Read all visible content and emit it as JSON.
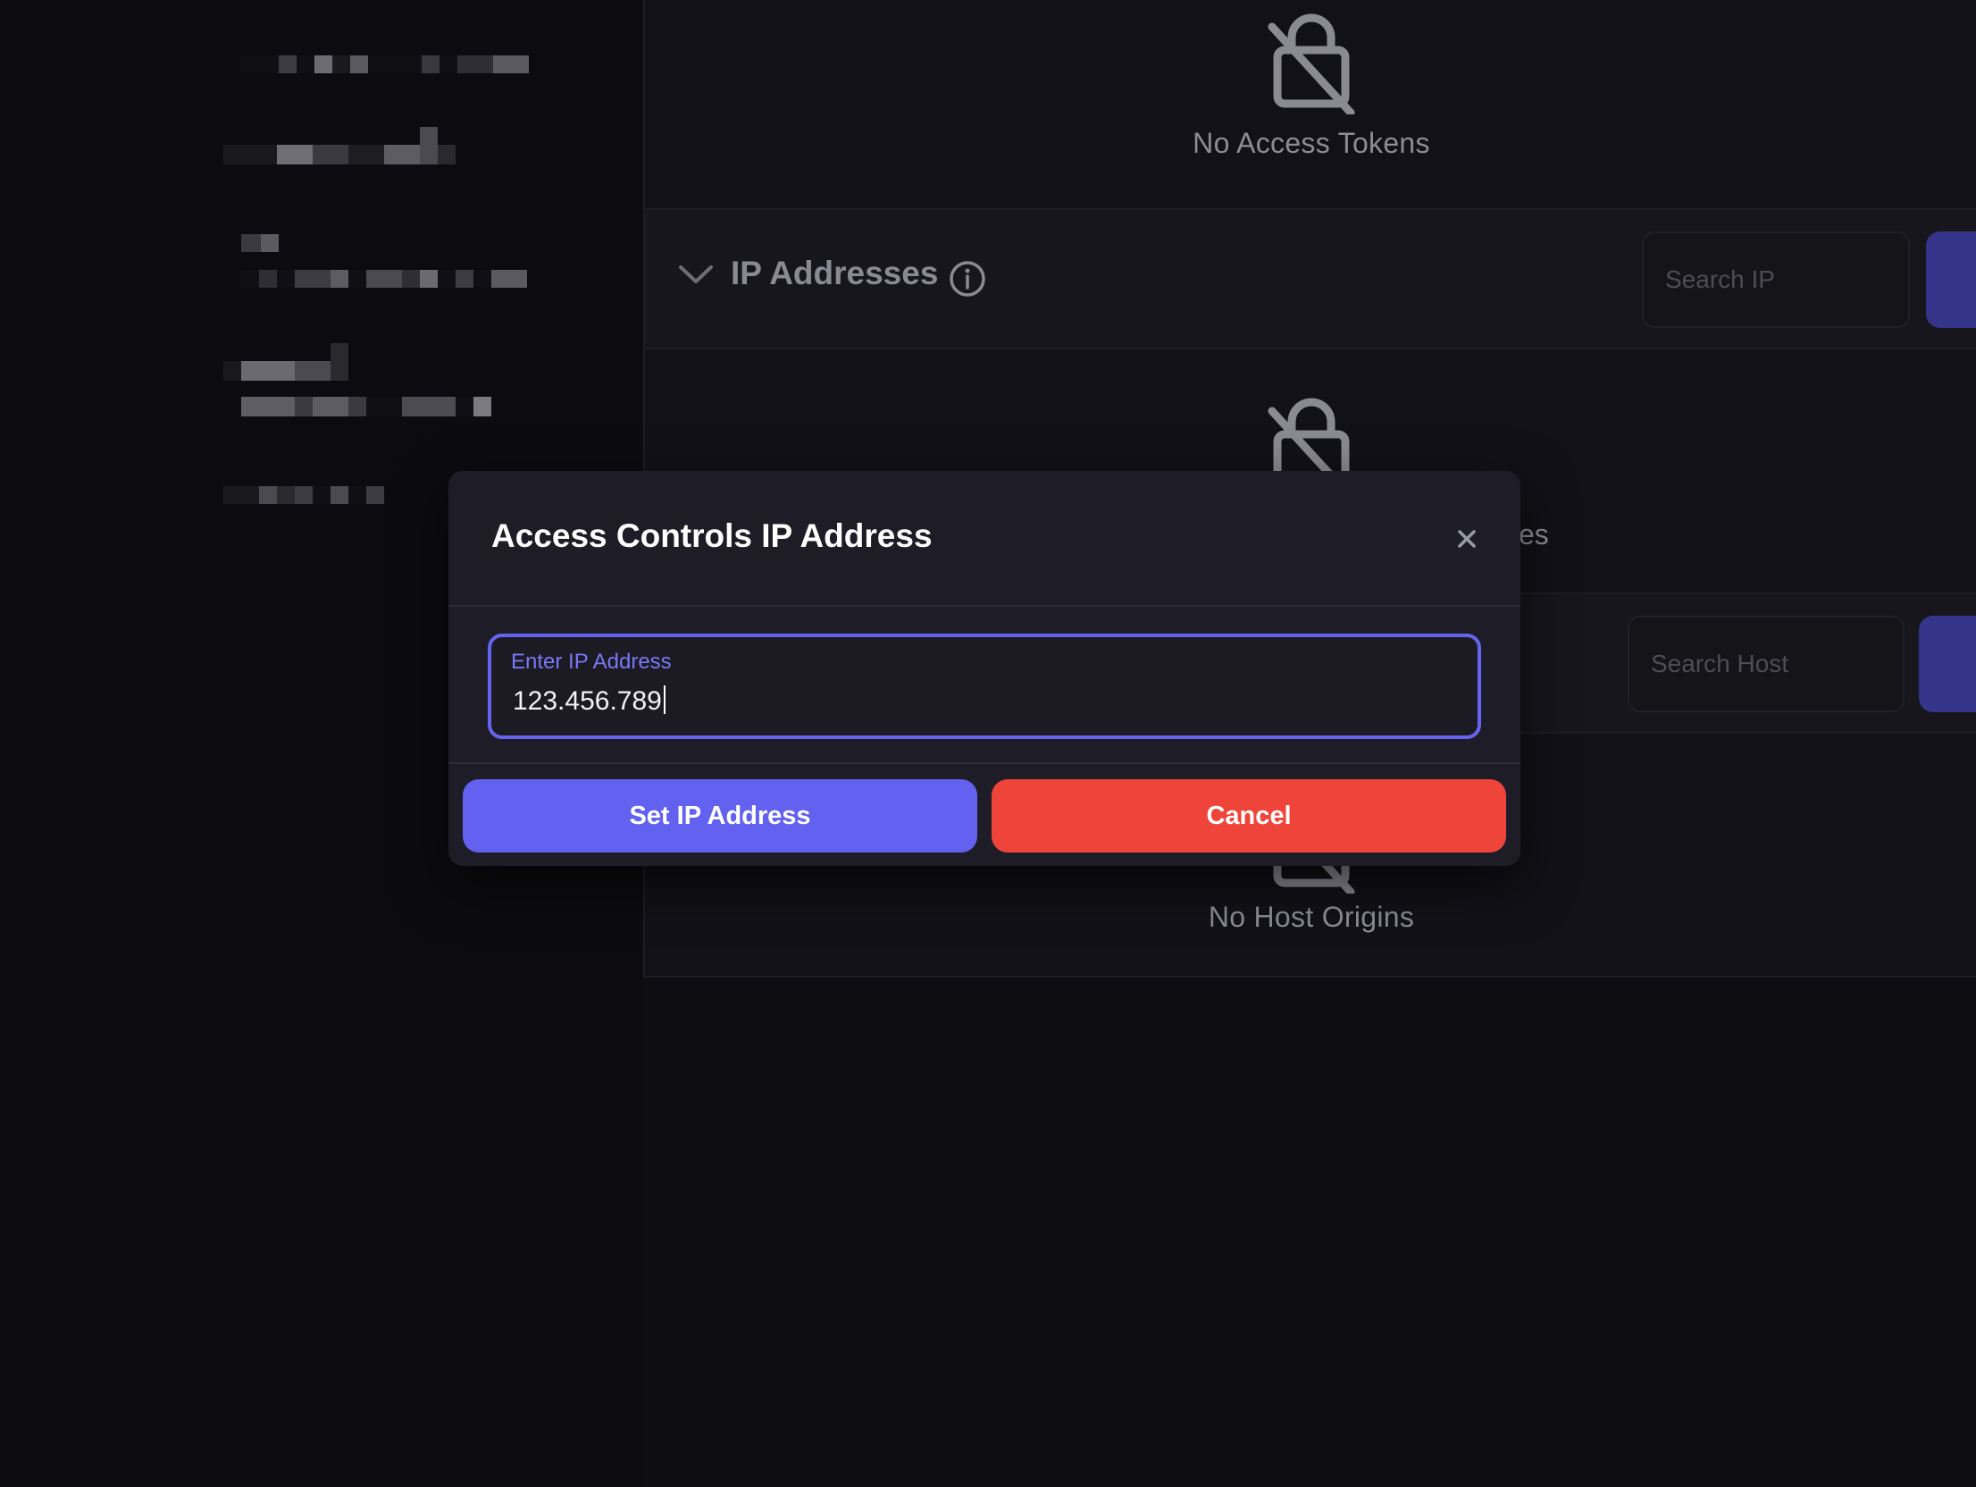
{
  "sections": {
    "access_tokens": {
      "empty_text": "No Access Tokens"
    },
    "ip_addresses": {
      "title": "IP Addresses",
      "search_placeholder": "Search IP",
      "empty_text_partial": "ses"
    },
    "host_origins": {
      "search_placeholder": "Search Host",
      "empty_text": "No Host Origins"
    }
  },
  "modal": {
    "title": "Access Controls IP Address",
    "field_label": "Enter IP Address",
    "field_value": "123.456.789",
    "primary_button": "Set IP Address",
    "cancel_button": "Cancel"
  },
  "colors": {
    "accent": "#6261f0",
    "danger": "#ef4439",
    "background": "#0d0d12",
    "modal_bg": "#1e1d27"
  },
  "icons": [
    "lock-off-icon",
    "chevron-down-icon",
    "info-icon",
    "close-icon"
  ]
}
